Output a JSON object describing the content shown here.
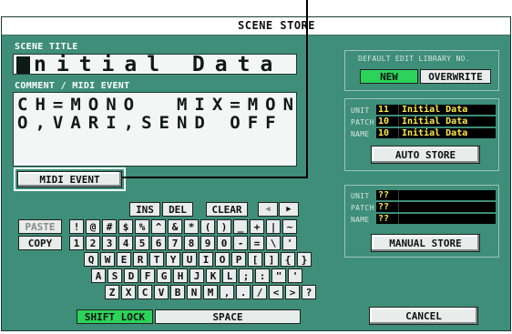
{
  "window": {
    "title": "SCENE STORE"
  },
  "scene_title": {
    "label": "SCENE TITLE",
    "value": "nitial Data"
  },
  "comment": {
    "label": "COMMENT / MIDI EVENT",
    "line1": "CH=MONO  MIX=MON",
    "line2": "O,VARI,SEND OFF"
  },
  "midi_event_button": "MIDI EVENT",
  "edit_keys": {
    "ins": "INS",
    "del": "DEL",
    "clear": "CLEAR",
    "left": "◀",
    "right": "▶"
  },
  "side_keys": {
    "paste": "PASTE",
    "copy": "COPY"
  },
  "keyboard_rows": [
    [
      "!",
      "@",
      "#",
      "$",
      "%",
      "^",
      "&",
      "*",
      "(",
      ")",
      "_",
      "+",
      "|",
      "~"
    ],
    [
      "1",
      "2",
      "3",
      "4",
      "5",
      "6",
      "7",
      "8",
      "9",
      "0",
      "-",
      "=",
      "\\",
      "'"
    ],
    [
      "Q",
      "W",
      "E",
      "R",
      "T",
      "Y",
      "U",
      "I",
      "O",
      "P",
      "[",
      "]",
      "{",
      "}"
    ],
    [
      "A",
      "S",
      "D",
      "F",
      "G",
      "H",
      "J",
      "K",
      "L",
      ";",
      ":",
      "\"",
      "'"
    ],
    [
      "Z",
      "X",
      "C",
      "V",
      "B",
      "N",
      "M",
      ",",
      ".",
      "/",
      "<",
      ">",
      "?"
    ]
  ],
  "shift_lock": "SHIFT LOCK",
  "space": "SPACE",
  "default_library": {
    "label": "DEFAULT EDIT LIBRARY NO.",
    "new": "NEW",
    "overwrite": "OVERWRITE"
  },
  "auto_store": {
    "unit_label": "UNIT",
    "unit_num": "11",
    "unit_name": "Initial Data",
    "patch_label": "PATCH",
    "patch_num": "10",
    "patch_name": "Initial Data",
    "name_label": "NAME",
    "name_num": "10",
    "name_name": "Initial Data",
    "button": "AUTO STORE"
  },
  "manual_store": {
    "unit_label": "UNIT",
    "unit_num": "??",
    "patch_label": "PATCH",
    "patch_num": "??",
    "name_label": "NAME",
    "name_num": "??",
    "button": "MANUAL STORE"
  },
  "cancel": "CANCEL",
  "colors": {
    "panel_bg": "#3e8e79",
    "active_green": "#2bd35a",
    "value_yellow": "#ffe94a"
  }
}
